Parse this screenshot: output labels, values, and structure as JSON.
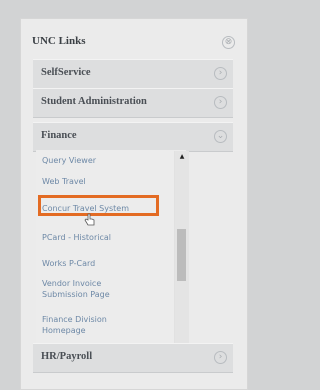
{
  "panel": {
    "title": "UNC Links",
    "sections": [
      {
        "label": "SelfService",
        "icon": "chevron-right-icon"
      },
      {
        "label": "Student Administration",
        "icon": "chevron-right-icon"
      },
      {
        "label": "Finance",
        "icon": "chevron-down-icon"
      },
      {
        "label": "HR/Payroll",
        "icon": "chevron-right-icon"
      }
    ],
    "finance_items": [
      {
        "label": "Query Viewer"
      },
      {
        "label": "Web Travel"
      },
      {
        "label": "Concur Travel System"
      },
      {
        "label": "PCard - Historical"
      },
      {
        "label": "Works P-Card"
      },
      {
        "label": "Vendor Invoice Submission Page"
      },
      {
        "label": "Finance Division Homepage"
      }
    ]
  },
  "colors": {
    "highlight": "#e36b23",
    "link": "#6d88a6",
    "background": "#d2d3d4"
  }
}
